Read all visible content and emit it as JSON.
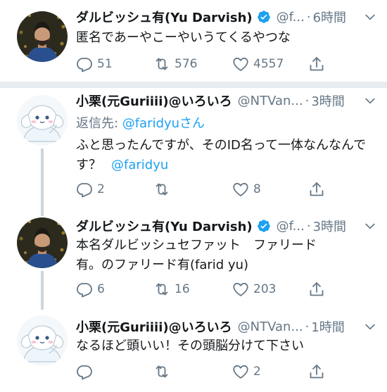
{
  "tweets": [
    {
      "name": "ダルビッシュ有(Yu Darvish)",
      "handle": "@f...",
      "dot": "·",
      "time": "6時間",
      "verified": true,
      "reply_to_label": "",
      "reply_to_user": "",
      "text": "匿名であーやこーやいうてくるやつな",
      "mention": "",
      "replies": "51",
      "retweets": "576",
      "likes": "4557"
    },
    {
      "name": "小栗(元Guriiii)@いろいろ",
      "handle": "@NTVan...",
      "dot": "·",
      "time": "3時間",
      "verified": false,
      "reply_to_label": "返信先: ",
      "reply_to_user": "@faridyuさん",
      "text": "ふと思ったんですが、そのID名って一体なんなんです？",
      "mention": "@faridyu",
      "replies": "2",
      "retweets": "",
      "likes": "8"
    },
    {
      "name": "ダルビッシュ有(Yu Darvish)",
      "handle": "@f...",
      "dot": "·",
      "time": "3時間",
      "verified": true,
      "reply_to_label": "",
      "reply_to_user": "",
      "text": "本名ダルビッシュセファット　ファリード有。のファリード有(farid yu)",
      "mention": "",
      "replies": "6",
      "retweets": "16",
      "likes": "203"
    },
    {
      "name": "小栗(元Guriiii)@いろいろ",
      "handle": "@NTVan...",
      "dot": "·",
      "time": "1時間",
      "verified": false,
      "reply_to_label": "",
      "reply_to_user": "",
      "text": "なるほど頭いい！その頭脳分けて下さい",
      "mention": "",
      "replies": "",
      "retweets": "",
      "likes": "2"
    }
  ],
  "colors": {
    "accent": "#1da1f2",
    "muted": "#657786",
    "divider": "#e6ecf0",
    "thread_line": "#ccd6dd"
  },
  "icons": {
    "verified": "verified-badge-icon",
    "caret": "chevron-down-icon",
    "reply": "reply-icon",
    "retweet": "retweet-icon",
    "like": "heart-icon",
    "share": "share-icon"
  }
}
